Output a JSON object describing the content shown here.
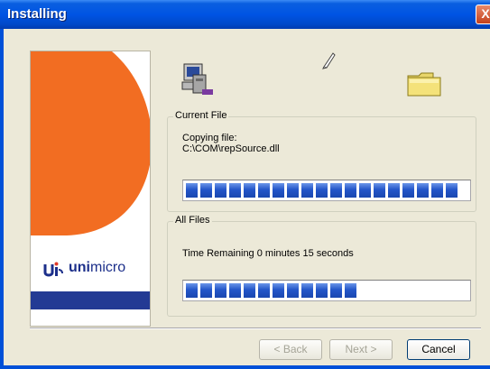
{
  "window": {
    "title": "Installing",
    "close_glyph": "X"
  },
  "branding": {
    "logo_bold": "uni",
    "logo_light": "micro",
    "colors": {
      "orange": "#f26d22",
      "navy": "#233a94"
    }
  },
  "icons": {
    "computer": "computer-install-icon",
    "transfer": "paper-transfer-icon",
    "folder": "folder-icon"
  },
  "current_file": {
    "legend": "Current File",
    "line1": "Copying file:",
    "line2": "C:\\COM\\repSource.dll",
    "progress": 0.98
  },
  "all_files": {
    "legend": "All Files",
    "status": "Time Remaining 0 minutes 15 seconds",
    "progress": 0.62
  },
  "buttons": {
    "back": "< Back",
    "next": "Next >",
    "cancel": "Cancel"
  }
}
